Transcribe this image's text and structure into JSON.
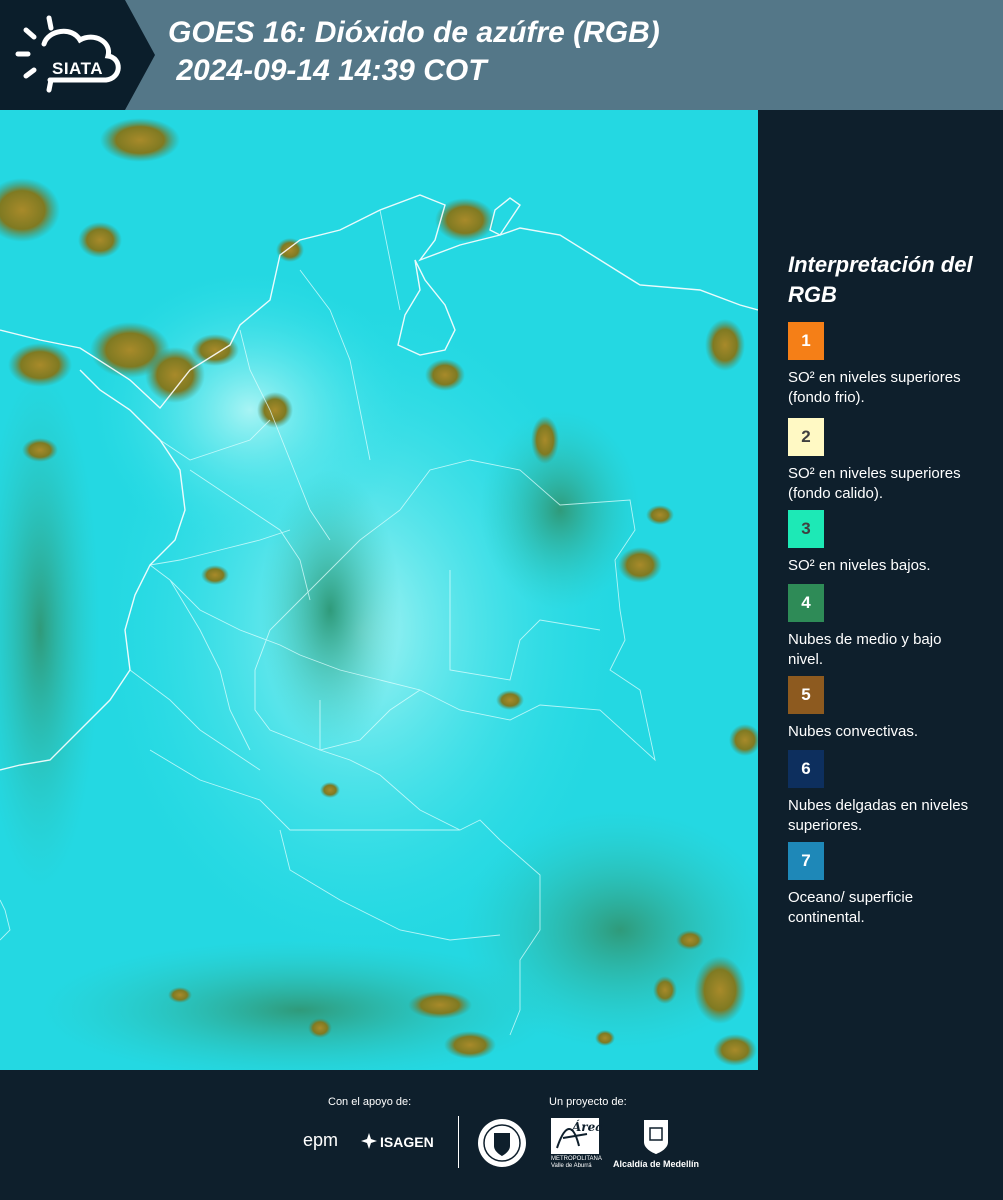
{
  "header": {
    "logo_text": "SIATA",
    "title": "GOES 16: Dióxido de azúfre (RGB)\n 2024-09-14 14:39 COT"
  },
  "legend": {
    "title": "Interpretación del RGB",
    "items": [
      {
        "number": "1",
        "color": "#f57f17",
        "text_color": "#ffffff",
        "description": "SO² en niveles superiores (fondo frio)."
      },
      {
        "number": "2",
        "color": "#fff9c4",
        "text_color": "#404040",
        "description": "SO² en niveles superiores (fondo calido)."
      },
      {
        "number": "3",
        "color": "#1de9b6",
        "text_color": "#404040",
        "description": "SO² en niveles bajos."
      },
      {
        "number": "4",
        "color": "#2e8b57",
        "text_color": "#ffffff",
        "description": "Nubes de medio y bajo nivel."
      },
      {
        "number": "5",
        "color": "#8d5a1f",
        "text_color": "#ffffff",
        "description": "Nubes convectivas."
      },
      {
        "number": "6",
        "color": "#0d2f5e",
        "text_color": "#ffffff",
        "description": "Nubes delgadas en niveles superiores."
      },
      {
        "number": "7",
        "color": "#1e88b8",
        "text_color": "#ffffff",
        "description": "Oceano/ superficie continental."
      }
    ]
  },
  "footer": {
    "support_label": "Con el apoyo de:",
    "project_label": "Un proyecto de:",
    "sponsor_epm": "epm",
    "sponsor_isagen": "ISAGEN",
    "partner_amva": "METROPOLITANA Valle de Aburrá",
    "partner_amva_script": "Área",
    "partner_alcaldia": "Alcaldía de Medellín"
  },
  "icons": [
    "sun-cloud-logo-icon",
    "isagen-icon",
    "medellin-seal-icon",
    "area-metropolitana-icon",
    "alcaldia-shield-icon"
  ]
}
